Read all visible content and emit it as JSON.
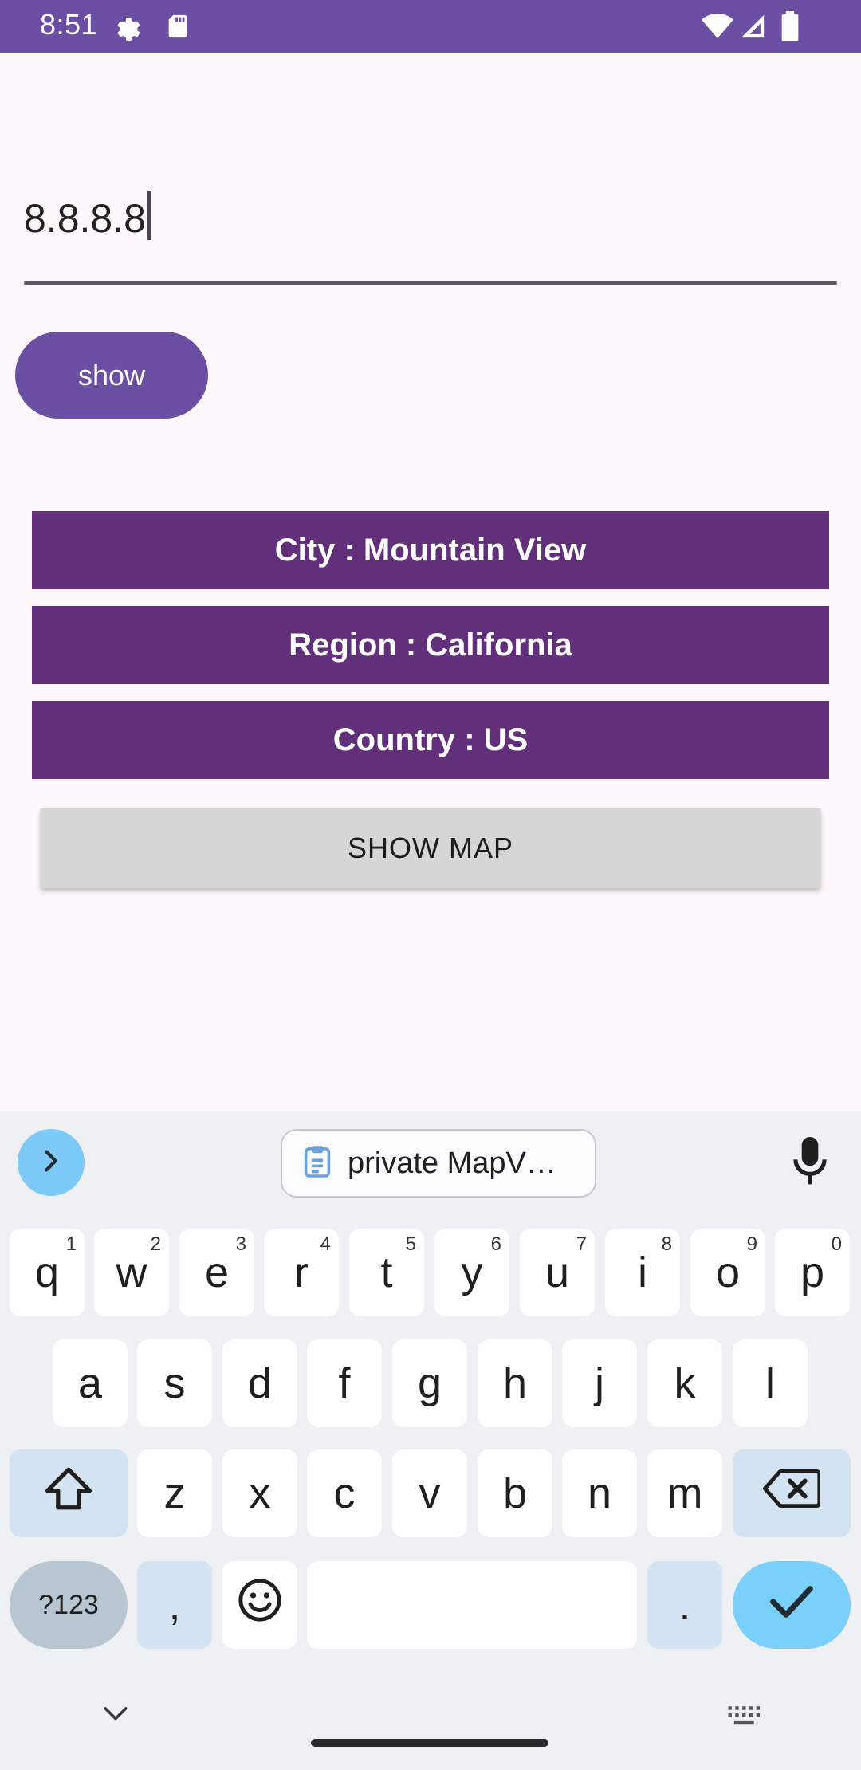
{
  "status_bar": {
    "time": "8:51",
    "icons": [
      "settings-icon",
      "sd-card-icon",
      "wifi-icon",
      "signal-icon",
      "battery-icon"
    ]
  },
  "ip_input": {
    "value": "8.8.8.8"
  },
  "show_button": {
    "label": "show"
  },
  "info": {
    "city": "City : Mountain View",
    "region": "Region : California",
    "country": "Country : US"
  },
  "show_map_button": {
    "label": "SHOW MAP"
  },
  "keyboard": {
    "clipboard_suggestion": "private MapV…",
    "row1": [
      {
        "key": "q",
        "hint": "1"
      },
      {
        "key": "w",
        "hint": "2"
      },
      {
        "key": "e",
        "hint": "3"
      },
      {
        "key": "r",
        "hint": "4"
      },
      {
        "key": "t",
        "hint": "5"
      },
      {
        "key": "y",
        "hint": "6"
      },
      {
        "key": "u",
        "hint": "7"
      },
      {
        "key": "i",
        "hint": "8"
      },
      {
        "key": "o",
        "hint": "9"
      },
      {
        "key": "p",
        "hint": "0"
      }
    ],
    "row2": [
      "a",
      "s",
      "d",
      "f",
      "g",
      "h",
      "j",
      "k",
      "l"
    ],
    "row3": [
      "z",
      "x",
      "c",
      "v",
      "b",
      "n",
      "m"
    ],
    "symbols_label": "?123",
    "comma": ",",
    "period": "."
  },
  "colors": {
    "primary": "#6a4fa3",
    "info_bar": "#62307b",
    "map_button": "#d6d6d6",
    "keyboard_accent": "#7ad0fb"
  }
}
